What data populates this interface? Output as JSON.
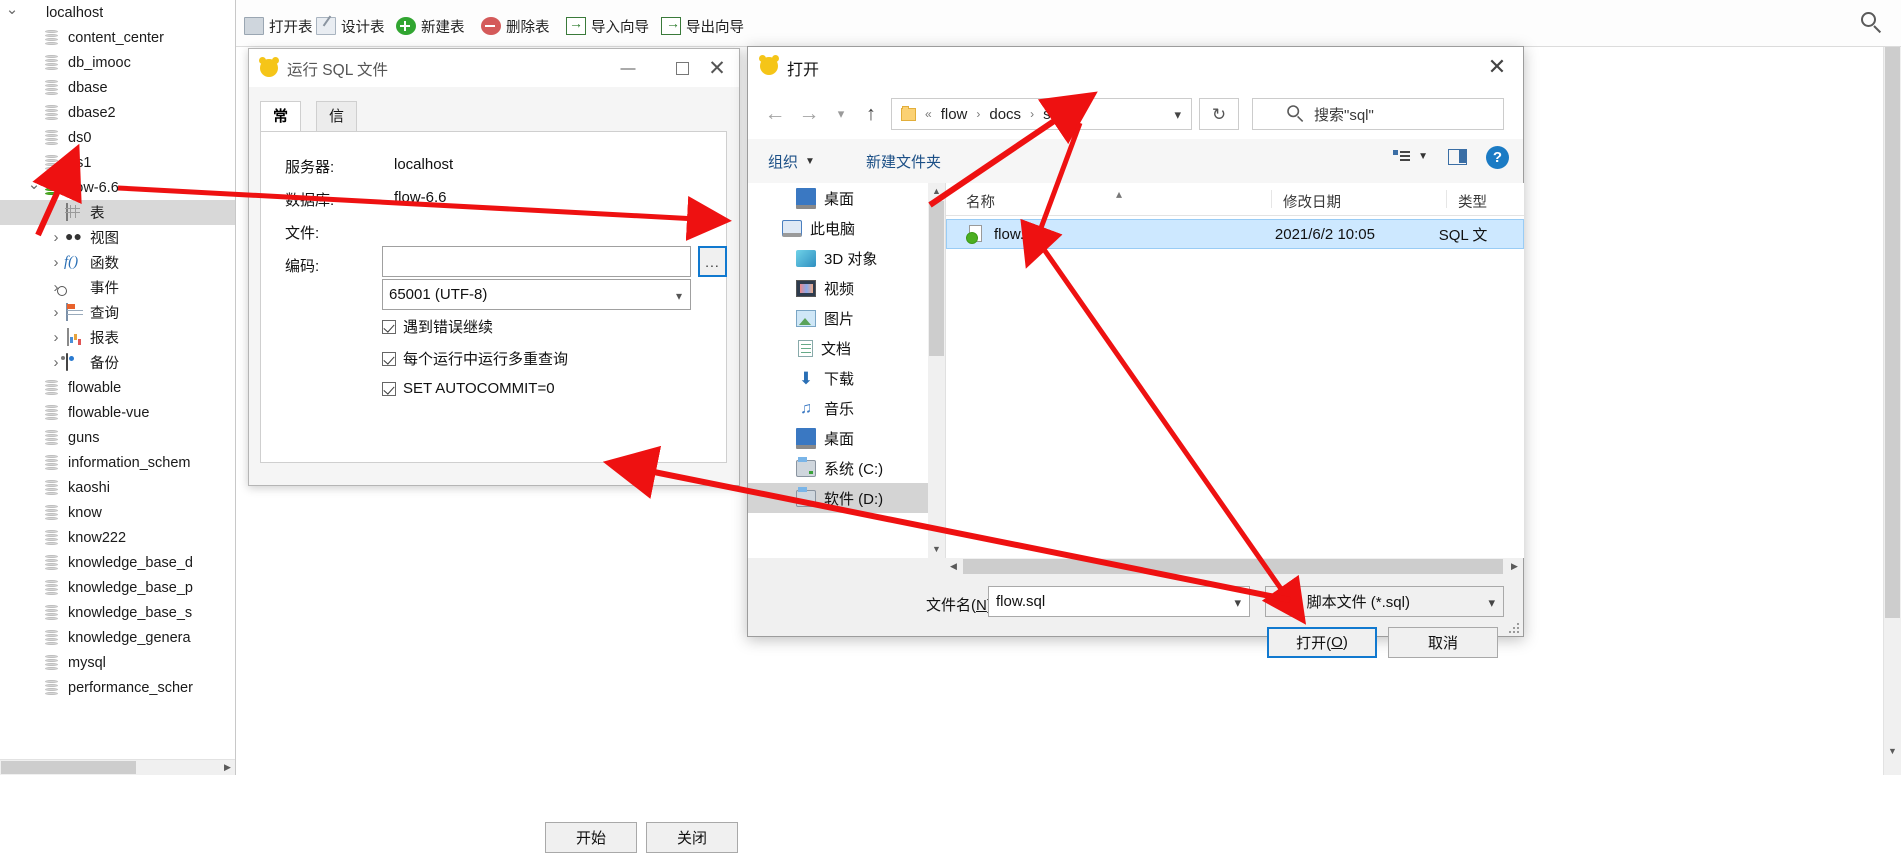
{
  "tree": {
    "root": {
      "label": "localhost",
      "icon": "connection-icon"
    },
    "items": [
      {
        "label": "content_center",
        "icon": "database-icon",
        "depth": 1,
        "chev": "none"
      },
      {
        "label": "db_imooc",
        "icon": "database-icon",
        "depth": 1,
        "chev": "none"
      },
      {
        "label": "dbase",
        "icon": "database-icon",
        "depth": 1,
        "chev": "none"
      },
      {
        "label": "dbase2",
        "icon": "database-icon",
        "depth": 1,
        "chev": "none"
      },
      {
        "label": "ds0",
        "icon": "database-icon",
        "depth": 1,
        "chev": "none"
      },
      {
        "label": "ds1",
        "icon": "database-icon",
        "depth": 1,
        "chev": "none"
      },
      {
        "label": "flow-6.6",
        "icon": "database-open-icon",
        "depth": 1,
        "chev": "down"
      },
      {
        "label": "表",
        "icon": "table-icon",
        "depth": 2,
        "chev": "none",
        "selected": true
      },
      {
        "label": "视图",
        "icon": "view-icon",
        "depth": 2,
        "chev": "right"
      },
      {
        "label": "函数",
        "icon": "function-icon",
        "depth": 2,
        "chev": "right"
      },
      {
        "label": "事件",
        "icon": "event-icon",
        "depth": 2,
        "chev": "right"
      },
      {
        "label": "查询",
        "icon": "query-icon",
        "depth": 2,
        "chev": "right"
      },
      {
        "label": "报表",
        "icon": "report-icon",
        "depth": 2,
        "chev": "right"
      },
      {
        "label": "备份",
        "icon": "backup-icon",
        "depth": 2,
        "chev": "right"
      },
      {
        "label": "flowable",
        "icon": "database-icon",
        "depth": 1,
        "chev": "none"
      },
      {
        "label": "flowable-vue",
        "icon": "database-icon",
        "depth": 1,
        "chev": "none"
      },
      {
        "label": "guns",
        "icon": "database-icon",
        "depth": 1,
        "chev": "none"
      },
      {
        "label": "information_schem",
        "icon": "database-icon",
        "depth": 1,
        "chev": "none"
      },
      {
        "label": "kaoshi",
        "icon": "database-icon",
        "depth": 1,
        "chev": "none"
      },
      {
        "label": "know",
        "icon": "database-icon",
        "depth": 1,
        "chev": "none"
      },
      {
        "label": "know222",
        "icon": "database-icon",
        "depth": 1,
        "chev": "none"
      },
      {
        "label": "knowledge_base_d",
        "icon": "database-icon",
        "depth": 1,
        "chev": "none"
      },
      {
        "label": "knowledge_base_p",
        "icon": "database-icon",
        "depth": 1,
        "chev": "none"
      },
      {
        "label": "knowledge_base_s",
        "icon": "database-icon",
        "depth": 1,
        "chev": "none"
      },
      {
        "label": "knowledge_genera",
        "icon": "database-icon",
        "depth": 1,
        "chev": "none"
      },
      {
        "label": "mysql",
        "icon": "database-icon",
        "depth": 1,
        "chev": "none"
      },
      {
        "label": "performance_scher",
        "icon": "database-icon",
        "depth": 1,
        "chev": "none"
      }
    ]
  },
  "toolbar": {
    "buttons": [
      {
        "label": "打开表",
        "icon": "open-table-icon"
      },
      {
        "label": "设计表",
        "icon": "design-table-icon"
      },
      {
        "label": "新建表",
        "icon": "new-table-icon"
      },
      {
        "label": "删除表",
        "icon": "delete-table-icon"
      },
      {
        "label": "导入向导",
        "icon": "import-wizard-icon"
      },
      {
        "label": "导出向导",
        "icon": "export-wizard-icon"
      }
    ]
  },
  "sql_dialog": {
    "title": "运行 SQL 文件",
    "minimize": "—",
    "tabs": [
      {
        "label": "常规",
        "active": true
      },
      {
        "label": "信息日志",
        "active": false
      }
    ],
    "fields": {
      "server_label": "服务器:",
      "server_value": "localhost",
      "database_label": "数据库:",
      "database_value": "flow-6.6",
      "file_label": "文件:",
      "file_value": "",
      "browse_label": "...",
      "encoding_label": "编码:",
      "encoding_value": "65001 (UTF-8)"
    },
    "checkboxes": [
      {
        "label": "遇到错误继续",
        "checked": true
      },
      {
        "label": "每个运行中运行多重查询",
        "checked": true
      },
      {
        "label": "SET AUTOCOMMIT=0",
        "checked": true
      }
    ],
    "start_button": "开始",
    "close_button": "关闭"
  },
  "open_dialog": {
    "title": "打开",
    "breadcrumb": [
      "flow",
      "docs",
      "sql"
    ],
    "breadcrumb_prefix": "«",
    "search_placeholder": "搜索\"sql\"",
    "commands": {
      "organize": "组织",
      "new_folder": "新建文件夹"
    },
    "nav_items": [
      {
        "label": "桌面",
        "icon": "desktop-icon",
        "indent": 1
      },
      {
        "label": "此电脑",
        "icon": "this-pc-icon",
        "indent": 0
      },
      {
        "label": "3D 对象",
        "icon": "3d-objects-icon",
        "indent": 1
      },
      {
        "label": "视频",
        "icon": "videos-icon",
        "indent": 1
      },
      {
        "label": "图片",
        "icon": "pictures-icon",
        "indent": 1
      },
      {
        "label": "文档",
        "icon": "documents-icon",
        "indent": 1
      },
      {
        "label": "下载",
        "icon": "downloads-icon",
        "indent": 1
      },
      {
        "label": "音乐",
        "icon": "music-icon",
        "indent": 1
      },
      {
        "label": "桌面",
        "icon": "desktop-icon",
        "indent": 1
      },
      {
        "label": "系统 (C:)",
        "icon": "drive-icon",
        "indent": 1
      },
      {
        "label": "软件 (D:)",
        "icon": "drive-icon",
        "indent": 1,
        "selected": true
      }
    ],
    "columns": [
      "名称",
      "修改日期",
      "类型"
    ],
    "files": [
      {
        "name": "flow.sql",
        "date": "2021/6/2 10:05",
        "type": "SQL 文",
        "selected": true
      }
    ],
    "filename_label": "文件名(N):",
    "filename_value": "flow.sql",
    "filter_value": "SQL 脚本文件 (*.sql)",
    "open_button": "打开(O)",
    "cancel_button": "取消"
  },
  "colors": {
    "accent": "#1179cf",
    "annotation": "#ee1111",
    "selection": "#cde8ff",
    "brand_yellow": "#f5c518"
  }
}
